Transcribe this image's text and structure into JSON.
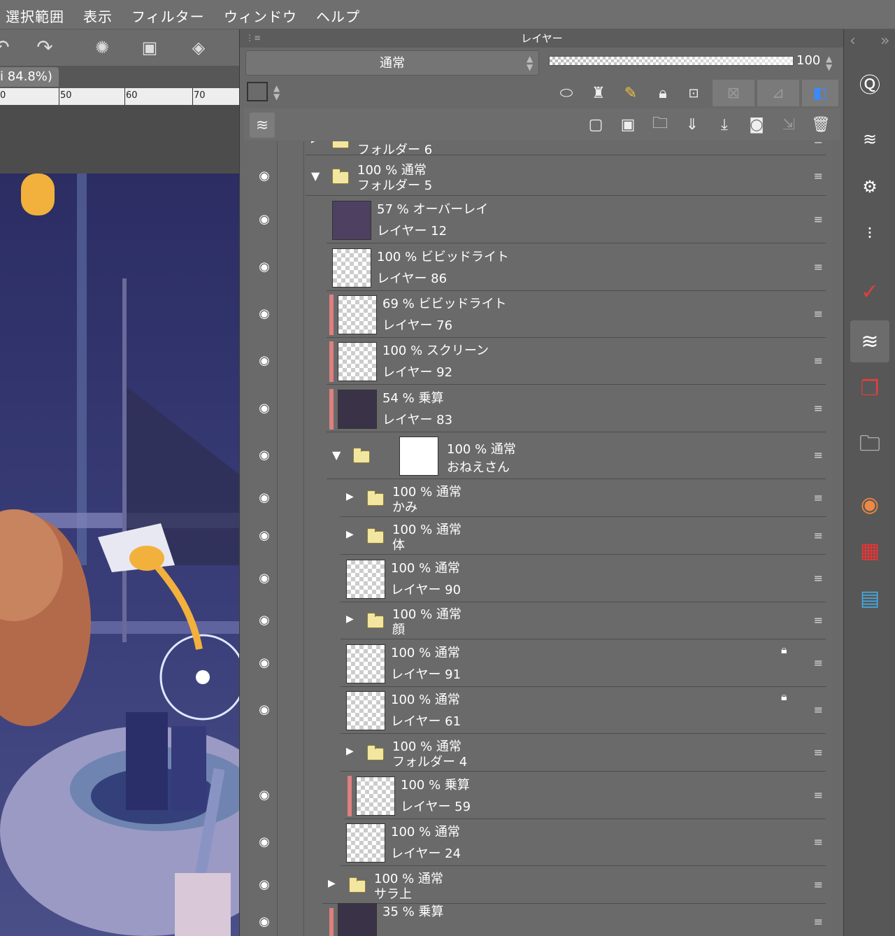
{
  "menu": [
    "選択範囲",
    "表示",
    "フィルター",
    "ウィンドウ",
    "ヘルプ"
  ],
  "document": {
    "tab_label": "i 84.8%)",
    "ruler_labels": [
      "0",
      "50",
      "60",
      "70"
    ]
  },
  "panel": {
    "title": "レイヤー",
    "blend_mode": "通常",
    "opacity": "100"
  },
  "layers": [
    {
      "kind": "folder",
      "line1": "",
      "line2": "フォルダー 6",
      "expanded": false,
      "visible": false
    },
    {
      "kind": "folder",
      "line1": "100 % 通常",
      "line2": "フォルダー 5",
      "expanded": true,
      "visible": true
    },
    {
      "kind": "layer",
      "line1": "57 % オーバーレイ",
      "line2": "レイヤー 12",
      "visible": true,
      "thumb": "#4d4060",
      "clip": false
    },
    {
      "kind": "layer",
      "line1": "100 % ビビッドライト",
      "line2": "レイヤー 86",
      "visible": true,
      "thumb": "checker",
      "clip": false
    },
    {
      "kind": "layer",
      "line1": "69 % ビビッドライト",
      "line2": "レイヤー 76",
      "visible": true,
      "thumb": "checker",
      "clip": true
    },
    {
      "kind": "layer",
      "line1": "100 % スクリーン",
      "line2": "レイヤー 92",
      "visible": true,
      "thumb": "checker",
      "clip": true
    },
    {
      "kind": "layer",
      "line1": "54 % 乗算",
      "line2": "レイヤー 83",
      "visible": true,
      "thumb": "#3a3348",
      "clip": true
    },
    {
      "kind": "folder",
      "line1": "100 % 通常",
      "line2": "おねえさん",
      "expanded": true,
      "visible": true
    },
    {
      "kind": "folder",
      "line1": "100 % 通常",
      "line2": "かみ",
      "expanded": false,
      "visible": true
    },
    {
      "kind": "folder",
      "line1": "100 % 通常",
      "line2": "体",
      "expanded": false,
      "visible": true
    },
    {
      "kind": "layer",
      "line1": "100 % 通常",
      "line2": "レイヤー 90",
      "visible": true,
      "thumb": "checker",
      "clip": false
    },
    {
      "kind": "folder",
      "line1": "100 % 通常",
      "line2": "顔",
      "expanded": false,
      "visible": true
    },
    {
      "kind": "layer",
      "line1": "100 % 通常",
      "line2": "レイヤー 91",
      "visible": true,
      "thumb": "checker",
      "clip": false,
      "locked": true
    },
    {
      "kind": "layer",
      "line1": "100 % 通常",
      "line2": "レイヤー 61",
      "visible": true,
      "thumb": "checker",
      "clip": false,
      "locked": true
    },
    {
      "kind": "folder",
      "line1": "100 % 通常",
      "line2": "フォルダー 4",
      "expanded": false,
      "visible": false
    },
    {
      "kind": "layer",
      "line1": "100 % 乗算",
      "line2": "レイヤー 59",
      "visible": true,
      "thumb": "checker",
      "clip": true
    },
    {
      "kind": "layer",
      "line1": "100 % 通常",
      "line2": "レイヤー 24",
      "visible": true,
      "thumb": "checker",
      "clip": false
    },
    {
      "kind": "folder",
      "line1": "100 % 通常",
      "line2": "サラ上",
      "expanded": false,
      "visible": true
    },
    {
      "kind": "layer",
      "line1": "35 % 乗算",
      "line2": "",
      "visible": true,
      "thumb": "#3a3348",
      "clip": true
    }
  ],
  "colors": {
    "menubar": "#6f6f6f",
    "panel": "#696969",
    "clip": "#e07f7f",
    "folder": "#f3e6a0"
  }
}
